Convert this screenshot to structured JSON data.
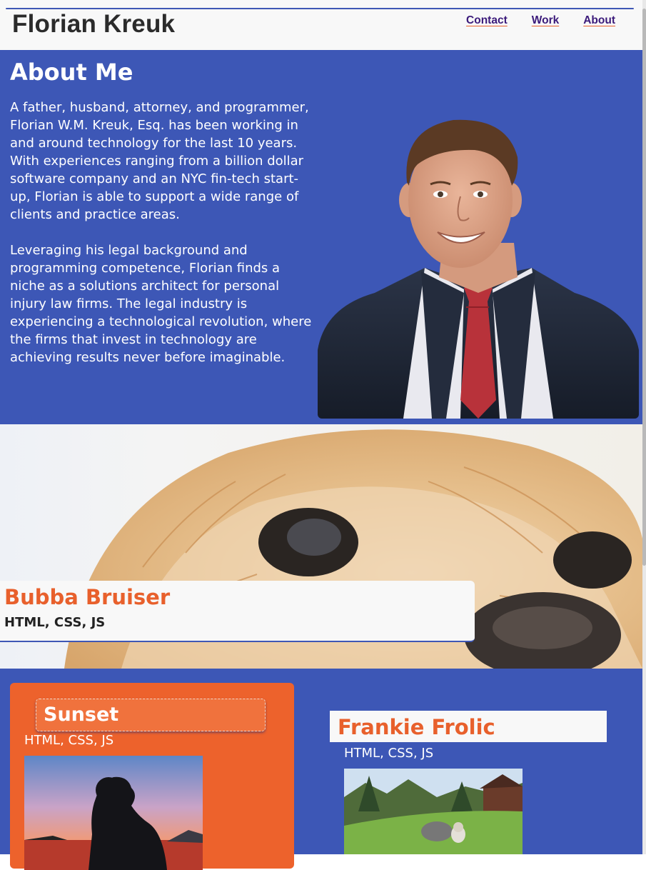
{
  "header": {
    "title": "Florian Kreuk",
    "nav": [
      {
        "label": "Contact"
      },
      {
        "label": "Work"
      },
      {
        "label": "About"
      }
    ]
  },
  "about": {
    "heading": "About Me",
    "paragraph1": "A father, husband, attorney, and programmer, Florian W.M. Kreuk, Esq. has been working in and around technology for the last 10 years. With experiences ranging from a billion dollar software company and an NYC fin-tech start-up, Florian is able to support a wide range of clients and practice areas.",
    "paragraph2": "Leveraging his legal background and programming competence, Florian finds a niche as a solutions architect for personal injury law firms. The legal industry is experiencing a technological revolution, where the firms that invest in technology are achieving results never before imaginable."
  },
  "projects": [
    {
      "title": "Bubba Bruiser",
      "tech": "HTML, CSS, JS"
    },
    {
      "title": "Sunset",
      "tech": "HTML, CSS, JS"
    },
    {
      "title": "Frankie Frolic",
      "tech": "HTML, CSS, JS"
    }
  ],
  "colors": {
    "primary_blue": "#3d57b6",
    "accent_orange": "#e8602c",
    "header_bg": "#f8f8f8"
  }
}
